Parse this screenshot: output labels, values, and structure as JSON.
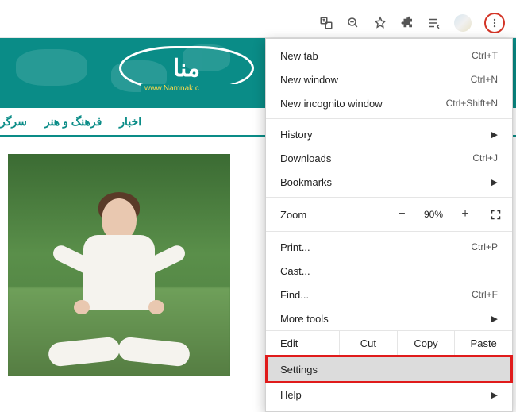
{
  "toolbar": {
    "translate_icon": "translate-icon",
    "zoomout_icon": "zoom-out-icon",
    "star_icon": "star-icon",
    "ext_icon": "puzzle-icon",
    "playlist_icon": "reading-list-icon",
    "avatar_icon": "profile-avatar",
    "more_icon": "more-vert-icon"
  },
  "site": {
    "logo_text": "منا",
    "logo_url": "www.Namnak.c",
    "nav": [
      "سرگر",
      "فرهنگ و هنر",
      "اخبار"
    ]
  },
  "menu": {
    "new_tab": {
      "label": "New tab",
      "accel": "Ctrl+T"
    },
    "new_window": {
      "label": "New window",
      "accel": "Ctrl+N"
    },
    "incognito": {
      "label": "New incognito window",
      "accel": "Ctrl+Shift+N"
    },
    "history": {
      "label": "History"
    },
    "downloads": {
      "label": "Downloads",
      "accel": "Ctrl+J"
    },
    "bookmarks": {
      "label": "Bookmarks"
    },
    "zoom": {
      "label": "Zoom",
      "minus": "−",
      "value": "90%",
      "plus": "+"
    },
    "print": {
      "label": "Print...",
      "accel": "Ctrl+P"
    },
    "cast": {
      "label": "Cast..."
    },
    "find": {
      "label": "Find...",
      "accel": "Ctrl+F"
    },
    "more_tools": {
      "label": "More tools"
    },
    "edit": {
      "label": "Edit",
      "cut": "Cut",
      "copy": "Copy",
      "paste": "Paste"
    },
    "settings": {
      "label": "Settings"
    },
    "help": {
      "label": "Help"
    }
  }
}
